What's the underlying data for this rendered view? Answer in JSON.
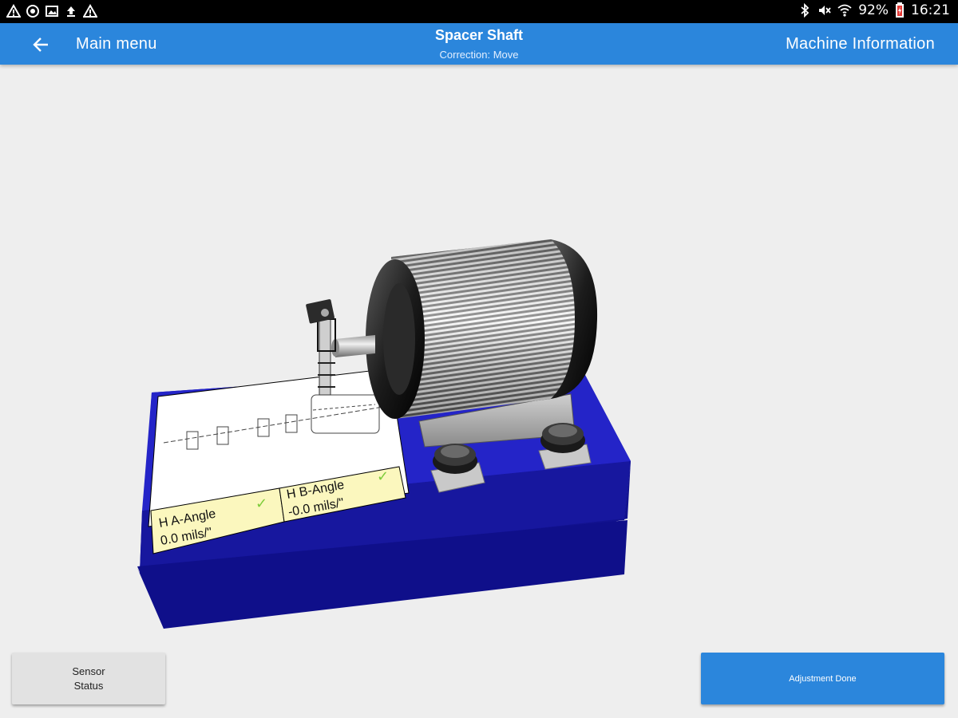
{
  "status_bar": {
    "battery": "92%",
    "time": "16:21",
    "left_icons": [
      "warning-icon",
      "gps-icon",
      "gallery-icon",
      "upload-icon",
      "warning-icon"
    ],
    "right_icons": [
      "bluetooth-icon",
      "mute-icon",
      "wifi-icon",
      "battery-icon"
    ]
  },
  "app_bar": {
    "back_label": "Main menu",
    "title": "Spacer Shaft",
    "subtitle": "Correction: Move",
    "right_label": "Machine Information"
  },
  "scene": {
    "angle_a_label": "H A-Angle",
    "angle_a_value": "0.0 mils/\"",
    "angle_b_label": "H B-Angle",
    "angle_b_value": "-0.0 mils/\"",
    "check_mark": "✓"
  },
  "buttons": {
    "sensor_status_line1": "Sensor",
    "sensor_status_line2": "Status",
    "adjustment_done": "Adjustment Done"
  },
  "colors": {
    "app_bar": "#2b86dc",
    "base_blue": "#1a1aa8",
    "angle_box": "#fbf7be",
    "check_green": "#7dcc3a"
  }
}
